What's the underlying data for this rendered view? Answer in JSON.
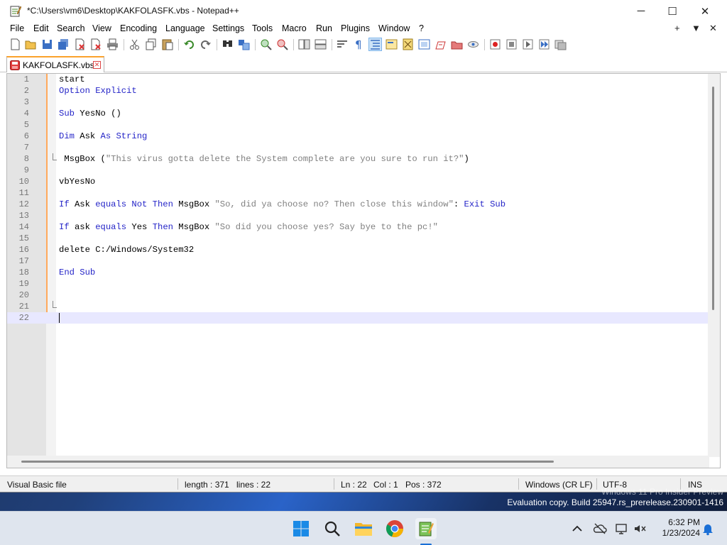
{
  "window": {
    "title": "*C:\\Users\\vm6\\Desktop\\KAKFOLASFK.vbs - Notepad++",
    "minimize_label": "─",
    "maximize_label": "☐",
    "close_label": "✕"
  },
  "menu": {
    "items": [
      "File",
      "Edit",
      "Search",
      "View",
      "Encoding",
      "Language",
      "Settings",
      "Tools",
      "Macro",
      "Run",
      "Plugins",
      "Window",
      "?"
    ],
    "right": [
      "+",
      "▼",
      "✕"
    ]
  },
  "tab": {
    "label": "KAKFOLASFK.vbs",
    "close_label": "✕"
  },
  "editor": {
    "lines": [
      {
        "n": "1",
        "segs": [
          {
            "t": "start",
            "c": "n"
          }
        ]
      },
      {
        "n": "2",
        "segs": [
          {
            "t": "Option Explicit",
            "c": "k"
          }
        ]
      },
      {
        "n": "3",
        "segs": []
      },
      {
        "n": "4",
        "segs": [
          {
            "t": "Sub",
            "c": "k"
          },
          {
            "t": " YesNo ()",
            "c": "n"
          }
        ]
      },
      {
        "n": "5",
        "segs": []
      },
      {
        "n": "6",
        "segs": [
          {
            "t": "Dim",
            "c": "k"
          },
          {
            "t": " Ask ",
            "c": "n"
          },
          {
            "t": "As String",
            "c": "k"
          }
        ]
      },
      {
        "n": "7",
        "segs": []
      },
      {
        "n": "8",
        "segs": [
          {
            "t": " MsgBox (",
            "c": "n"
          },
          {
            "t": "\"This virus gotta delete the System complete are you sure to run it?\"",
            "c": "s"
          },
          {
            "t": ")",
            "c": "n"
          }
        ],
        "fold": true
      },
      {
        "n": "9",
        "segs": []
      },
      {
        "n": "10",
        "segs": [
          {
            "t": "vbYesNo",
            "c": "n"
          }
        ]
      },
      {
        "n": "11",
        "segs": []
      },
      {
        "n": "12",
        "segs": [
          {
            "t": "If",
            "c": "k"
          },
          {
            "t": " Ask ",
            "c": "n"
          },
          {
            "t": "equals Not Then",
            "c": "k"
          },
          {
            "t": " MsgBox ",
            "c": "n"
          },
          {
            "t": "\"So, did ya choose no? Then close this window\"",
            "c": "s"
          },
          {
            "t": ": ",
            "c": "n"
          },
          {
            "t": "Exit Sub",
            "c": "k"
          }
        ]
      },
      {
        "n": "13",
        "segs": []
      },
      {
        "n": "14",
        "segs": [
          {
            "t": "If",
            "c": "k"
          },
          {
            "t": " ask ",
            "c": "n"
          },
          {
            "t": "equals",
            "c": "k"
          },
          {
            "t": " Yes ",
            "c": "n"
          },
          {
            "t": "Then",
            "c": "k"
          },
          {
            "t": " MsgBox ",
            "c": "n"
          },
          {
            "t": "\"So did you choose yes? Say bye to the pc!\"",
            "c": "s"
          }
        ]
      },
      {
        "n": "15",
        "segs": []
      },
      {
        "n": "16",
        "segs": [
          {
            "t": "delete C:/Windows/System32",
            "c": "n"
          }
        ]
      },
      {
        "n": "17",
        "segs": []
      },
      {
        "n": "18",
        "segs": [
          {
            "t": "End Sub",
            "c": "k"
          }
        ]
      },
      {
        "n": "19",
        "segs": []
      },
      {
        "n": "20",
        "segs": []
      },
      {
        "n": "21",
        "segs": [],
        "fold": true
      },
      {
        "n": "22",
        "segs": [],
        "current": true
      }
    ]
  },
  "status": {
    "file_type": "Visual Basic file",
    "length": "length : 371",
    "lines": "lines : 22",
    "ln": "Ln : 22",
    "col": "Col : 1",
    "pos": "Pos : 372",
    "eol": "Windows (CR LF)",
    "encoding": "UTF-8",
    "mode": "INS"
  },
  "watermark": {
    "line1": "Windows 11 Pro Insider Preview",
    "line2": "Evaluation copy. Build 25947.rs_prerelease.230901-1416"
  },
  "taskbar": {
    "time": "6:32 PM",
    "date": "1/23/2024"
  },
  "colors": {
    "keyword": "#2525c8",
    "string": "#808080",
    "tab_accent": "#fba22c",
    "current_line": "#e8e8ff"
  }
}
